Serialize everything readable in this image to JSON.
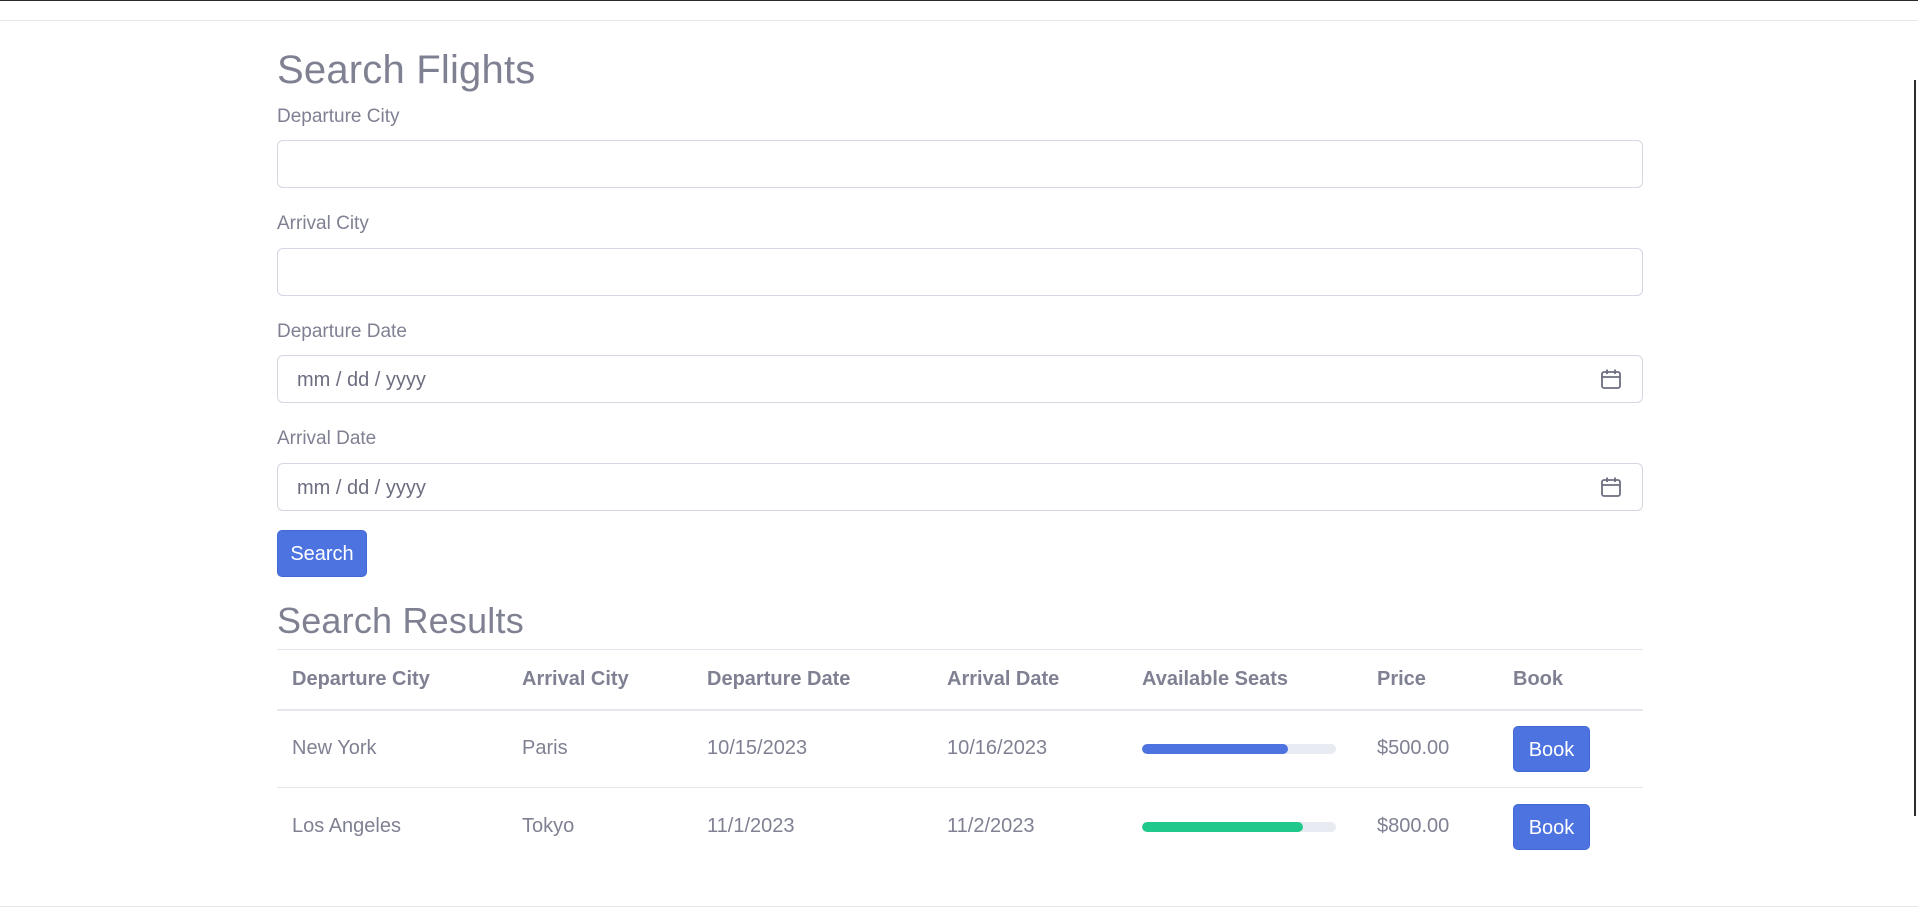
{
  "page": {
    "title": "Search Flights",
    "results_title": "Search Results"
  },
  "form": {
    "departure_city": {
      "label": "Departure City",
      "value": ""
    },
    "arrival_city": {
      "label": "Arrival City",
      "value": ""
    },
    "departure_date": {
      "label": "Departure Date",
      "placeholder": "mm / dd / yyyy",
      "icon": "calendar-icon"
    },
    "arrival_date": {
      "label": "Arrival Date",
      "placeholder": "mm / dd / yyyy",
      "icon": "calendar-icon"
    },
    "search_label": "Search"
  },
  "table": {
    "headers": [
      "Departure City",
      "Arrival City",
      "Departure Date",
      "Arrival Date",
      "Available Seats",
      "Price",
      "Book"
    ],
    "rows": [
      {
        "departure_city": "New York",
        "arrival_city": "Paris",
        "departure_date": "10/15/2023",
        "arrival_date": "10/16/2023",
        "available_seats_fraction": 0.75,
        "seats_color": "#4c73e0",
        "price": "$500.00",
        "book_label": "Book"
      },
      {
        "departure_city": "Los Angeles",
        "arrival_city": "Tokyo",
        "departure_date": "11/1/2023",
        "arrival_date": "11/2/2023",
        "available_seats_fraction": 0.83,
        "seats_color": "#20c98b",
        "price": "$800.00",
        "book_label": "Book"
      }
    ]
  },
  "colors": {
    "accent": "#4c73e0",
    "text": "#7f8193",
    "border": "#d4d6e0",
    "success": "#20c98b"
  }
}
